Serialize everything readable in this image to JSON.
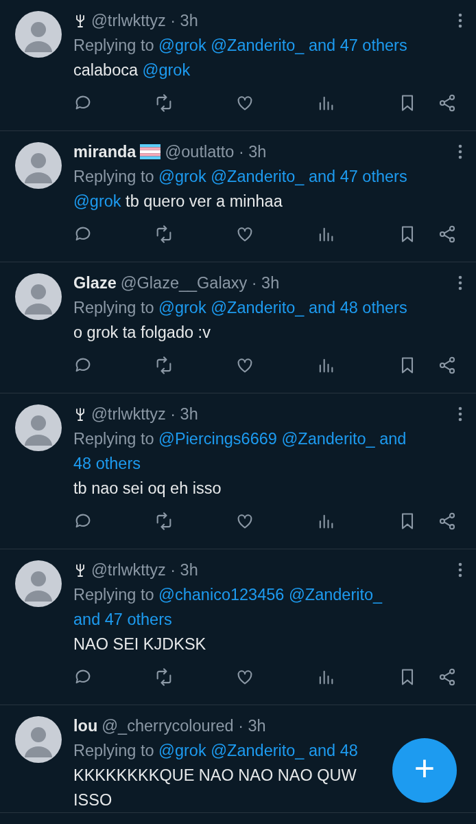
{
  "tweets": [
    {
      "tree_icon": true,
      "meta": "@trlwkttyz · 3h",
      "reply": {
        "prefix": "Replying to",
        "links": [
          "@grok",
          "@Zanderito_",
          "and 47 others"
        ]
      },
      "body": [
        {
          "kind": "text",
          "text": "calaboca"
        },
        {
          "kind": "mention",
          "text": "@grok"
        }
      ]
    },
    {
      "name": "miranda",
      "flag_icon": true,
      "meta": "@outlatto · 3h",
      "reply": {
        "prefix": "Replying to",
        "links": [
          "@grok",
          "@Zanderito_",
          "and 47 others"
        ]
      },
      "body": [
        {
          "kind": "mention",
          "text": "@grok"
        },
        {
          "kind": "text",
          "text": "tb quero ver a minhaa"
        }
      ]
    },
    {
      "name": "Glaze",
      "meta": "@Glaze__Galaxy · 3h",
      "reply": {
        "prefix": "Replying to",
        "links": [
          "@grok",
          "@Zanderito_",
          "and 48 others"
        ]
      },
      "body": [
        {
          "kind": "text",
          "text": "o grok ta folgado :v"
        }
      ]
    },
    {
      "tree_icon": true,
      "meta": "@trlwkttyz · 3h",
      "reply": {
        "prefix": "Replying to",
        "links": [
          "@Piercings6669",
          "@Zanderito_",
          "and",
          "48 others"
        ]
      },
      "body": [
        {
          "kind": "text",
          "text": "tb nao sei oq eh isso"
        }
      ]
    },
    {
      "tree_icon": true,
      "meta": "@trlwkttyz · 3h",
      "reply": {
        "prefix": "Replying to",
        "links": [
          "@chanico123456",
          "@Zanderito_",
          "and 47 others"
        ]
      },
      "body": [
        {
          "kind": "text",
          "text": "NAO SEI KJDKSK"
        }
      ]
    },
    {
      "name": "lou",
      "meta": "@_cherrycoloured · 3h",
      "reply": {
        "prefix": "Replying to",
        "links": [
          "@grok",
          "@Zanderito_",
          "and 48"
        ]
      },
      "body": [
        {
          "kind": "text",
          "text": "KKKKKKKKQUE NAO NAO NAO QUW ISSO"
        }
      ],
      "covered": true
    }
  ],
  "compose_button": {
    "label": "+"
  }
}
